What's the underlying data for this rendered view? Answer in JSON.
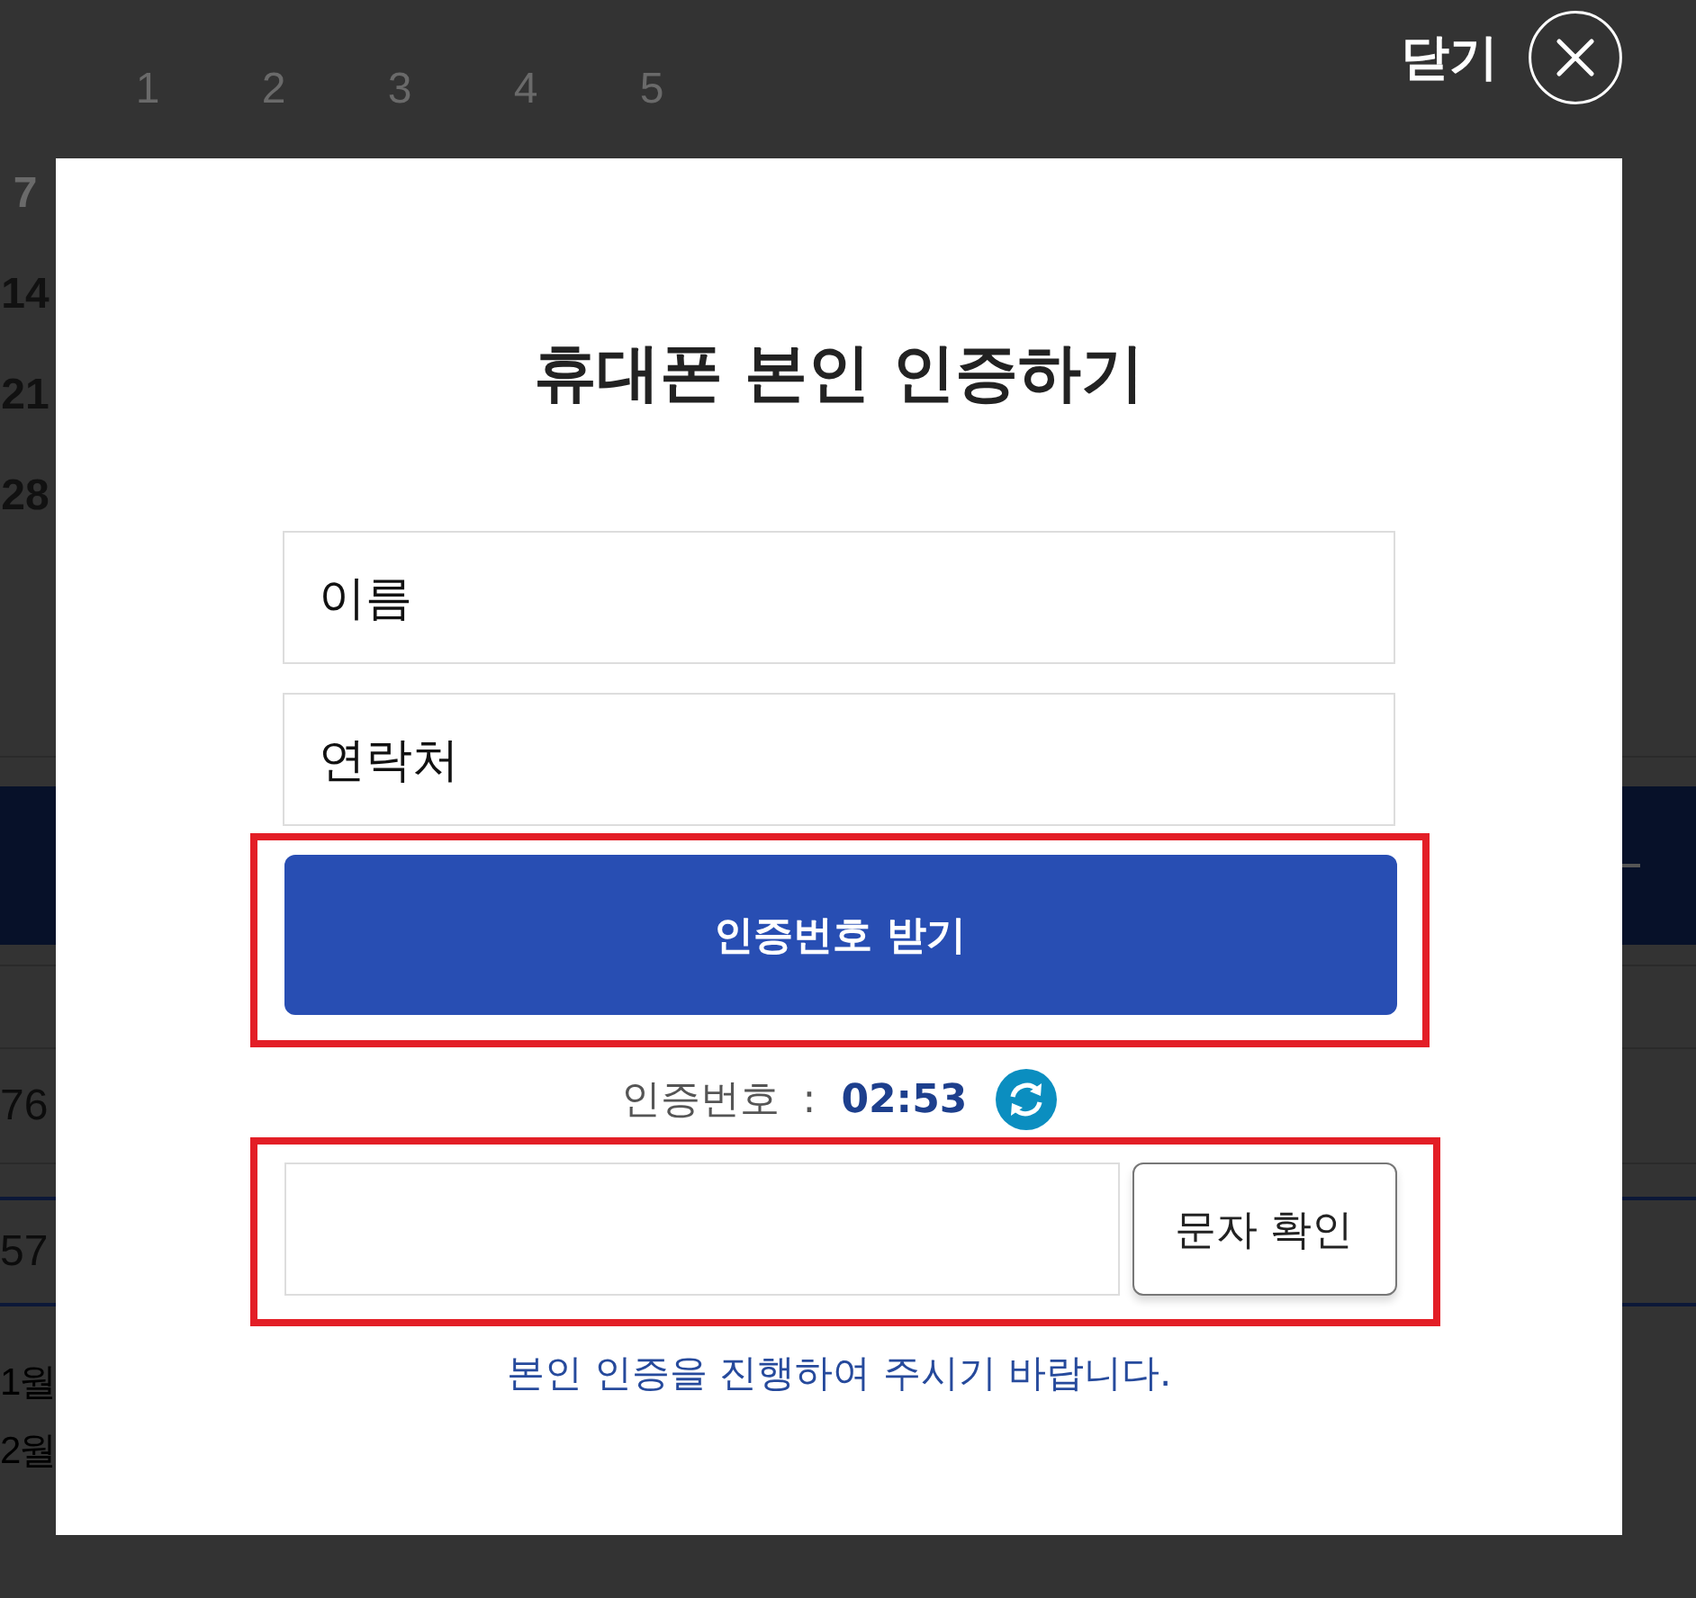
{
  "background_page": {
    "calendar_top_row": [
      {
        "label": "1",
        "dimmed": true
      },
      {
        "label": "2",
        "dimmed": true
      },
      {
        "label": "3",
        "dimmed": true
      },
      {
        "label": "4",
        "dimmed": true
      },
      {
        "label": "5",
        "dimmed": true
      }
    ],
    "calendar_left_column": [
      {
        "label": "7",
        "dimmed": true
      },
      {
        "label": "14",
        "dimmed": false
      },
      {
        "label": "21",
        "dimmed": false
      },
      {
        "label": "28",
        "dimmed": false
      }
    ],
    "list_rows": [
      {
        "text": "76",
        "selected": false
      },
      {
        "text": "57",
        "selected": true
      }
    ],
    "months": [
      "1월",
      "2월"
    ]
  },
  "close_button": {
    "label": "닫기"
  },
  "dialog": {
    "title": "휴대폰 본인 인증하기",
    "fields": [
      {
        "value": "이름"
      },
      {
        "value": "연락처"
      }
    ],
    "request_button": {
      "label": "인증번호 받기",
      "highlighted": true
    },
    "timer": {
      "label": "인증번호",
      "separator": ":",
      "time": "02:53"
    },
    "code_row": {
      "highlighted": true,
      "button": "문자 확인"
    },
    "message": "본인 인증을 진행하여 주시기 바랍니다."
  }
}
